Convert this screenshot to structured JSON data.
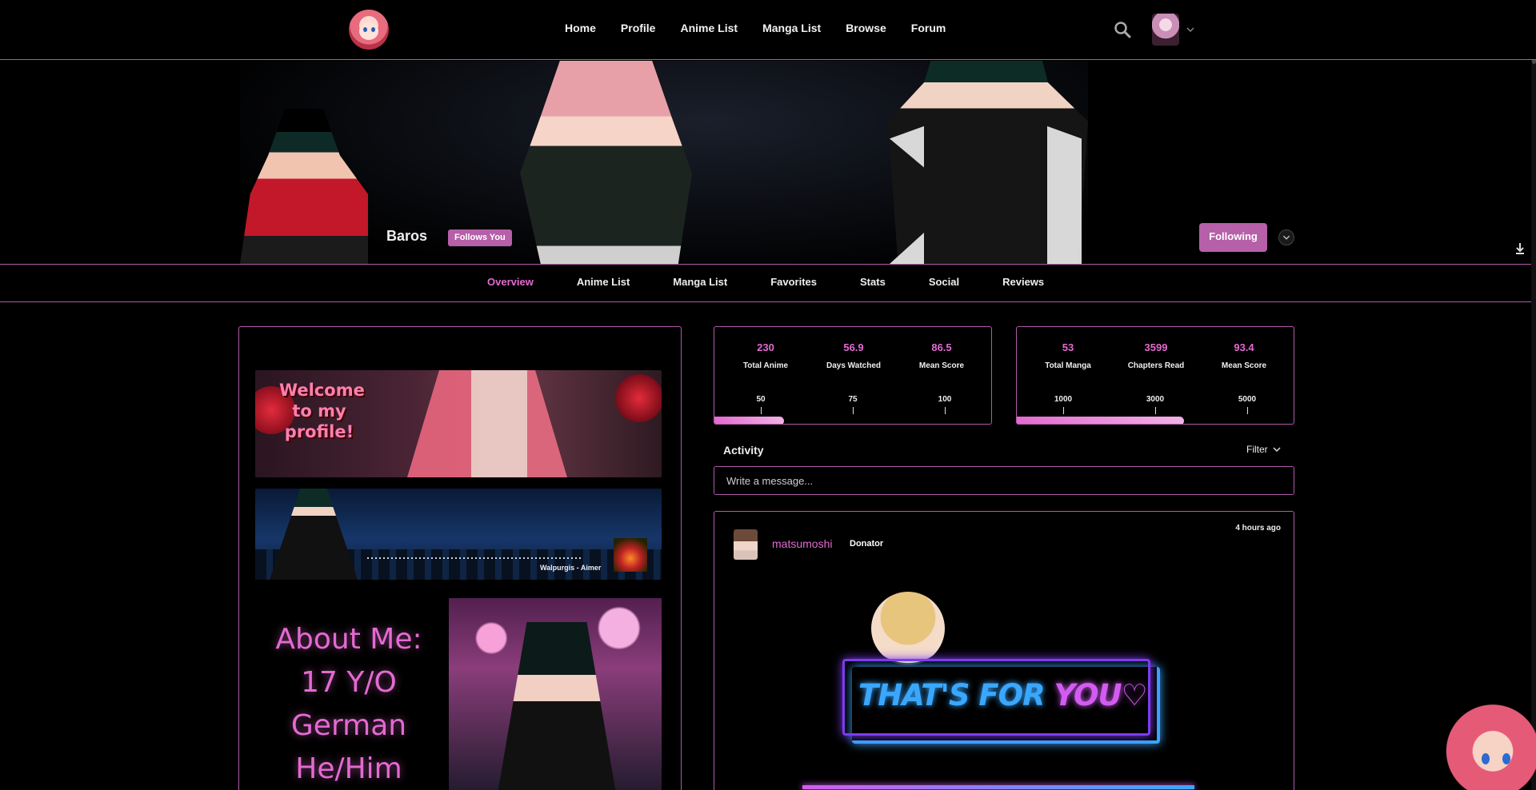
{
  "nav": {
    "links": [
      "Home",
      "Profile",
      "Anime List",
      "Manga List",
      "Browse",
      "Forum"
    ]
  },
  "profile": {
    "username": "Baros",
    "follows_badge": "Follows You",
    "following_button": "Following"
  },
  "tabs": [
    "Overview",
    "Anime List",
    "Manga List",
    "Favorites",
    "Stats",
    "Social",
    "Reviews"
  ],
  "bio": {
    "welcome_text": "Welcome to my profile!",
    "music_caption": "Walpurgis - Aimer",
    "about_lines": [
      "About Me:",
      "17 Y/O",
      "German",
      "He/Him"
    ]
  },
  "anime_stats": {
    "values": [
      "230",
      "56.9",
      "86.5"
    ],
    "labels": [
      "Total Anime",
      "Days Watched",
      "Mean Score"
    ],
    "milestones": [
      "50",
      "75",
      "100"
    ],
    "progress": 0.25
  },
  "manga_stats": {
    "values": [
      "53",
      "3599",
      "93.4"
    ],
    "labels": [
      "Total Manga",
      "Chapters Read",
      "Mean Score"
    ],
    "milestones": [
      "1000",
      "3000",
      "5000"
    ],
    "progress": 0.6
  },
  "activity": {
    "title": "Activity",
    "filter_label": "Filter",
    "message_placeholder": "Write a message...",
    "post": {
      "user": "matsumoshi",
      "badge": "Donator",
      "time": "4 hours ago",
      "image_text_1": "THAT'S FOR",
      "image_text_2": "YOU♡"
    }
  },
  "colors": {
    "accent": "#e36ad1",
    "border": "#b05aa8",
    "button": "#b560a8"
  },
  "icons": [
    "search-icon",
    "chevron-down-icon",
    "download-icon"
  ]
}
